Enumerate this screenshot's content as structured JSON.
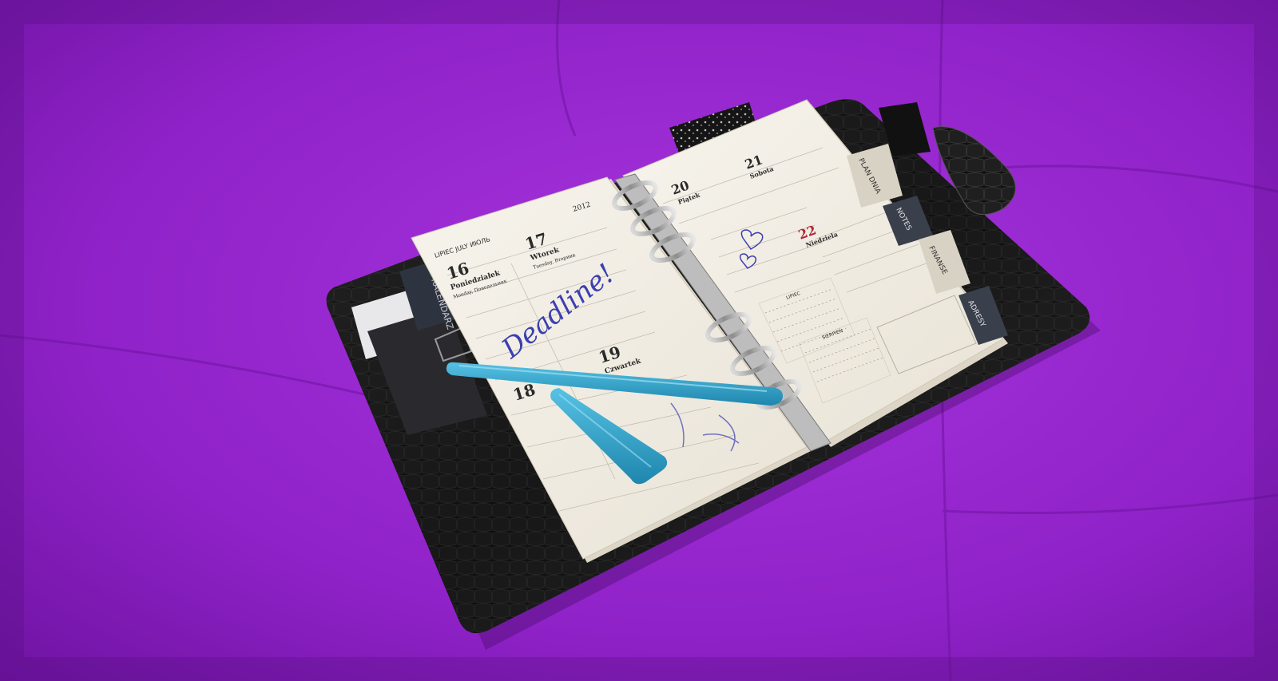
{
  "planner": {
    "year": "2012",
    "month_header": "LIPIEC JULY ИЮЛЬ",
    "days": [
      {
        "num": "16",
        "name": "Poniedziałek",
        "sub": "Monday, Понедельник"
      },
      {
        "num": "17",
        "name": "Wtorek",
        "sub": "Tuesday, Вторник"
      },
      {
        "num": "19",
        "name": "Czwartek",
        "sub": ""
      },
      {
        "num": "18",
        "name": "",
        "sub": ""
      },
      {
        "num": "20",
        "name": "Piątek",
        "sub": ""
      },
      {
        "num": "21",
        "name": "Sobota",
        "sub": ""
      },
      {
        "num": "22",
        "name": "Niedziela",
        "sub": ""
      }
    ],
    "mini_cal_title_1": "LIPIEC",
    "mini_cal_title_2": "SIERPIEŃ",
    "tabs": [
      "KALENDARZ",
      "PLAN DNIA",
      "NOTES",
      "FINANSE",
      "ADRESY"
    ],
    "handwriting": "Deadline!",
    "colors": {
      "background": "#8a1fc4",
      "cover": "#141414",
      "paper": "#f3efe6",
      "pen": "#2fa2c9",
      "ink": "#3b3fb0",
      "sunday": "#b0283c"
    }
  }
}
